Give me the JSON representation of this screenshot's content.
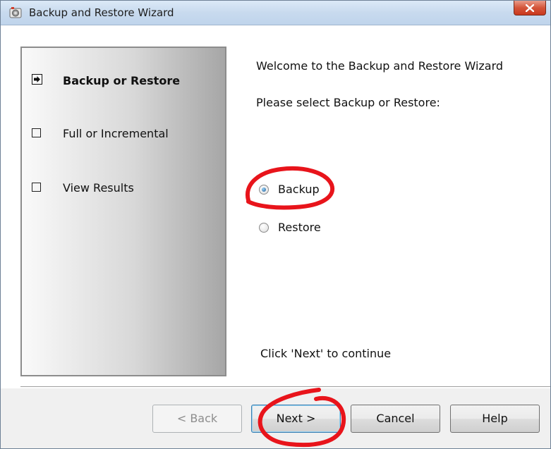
{
  "window": {
    "title": "Backup and Restore Wizard",
    "close_glyph": "✕"
  },
  "steps": [
    {
      "label": "Backup or Restore",
      "state": "current",
      "icon": "arrow-right-icon"
    },
    {
      "label": "Full or Incremental",
      "state": "pending",
      "icon": "checkbox-icon"
    },
    {
      "label": "View Results",
      "state": "pending",
      "icon": "checkbox-icon"
    }
  ],
  "main": {
    "welcome": "Welcome to the Backup and Restore Wizard",
    "prompt": "Please select Backup or Restore:",
    "options": [
      {
        "label": "Backup",
        "selected": true
      },
      {
        "label": "Restore",
        "selected": false
      }
    ],
    "continue_hint": "Click 'Next' to continue"
  },
  "buttons": {
    "back": "< Back",
    "next": "Next >",
    "cancel": "Cancel",
    "help": "Help"
  },
  "colors": {
    "annotation": "#e8141b",
    "accent": "#3c7fb1"
  }
}
